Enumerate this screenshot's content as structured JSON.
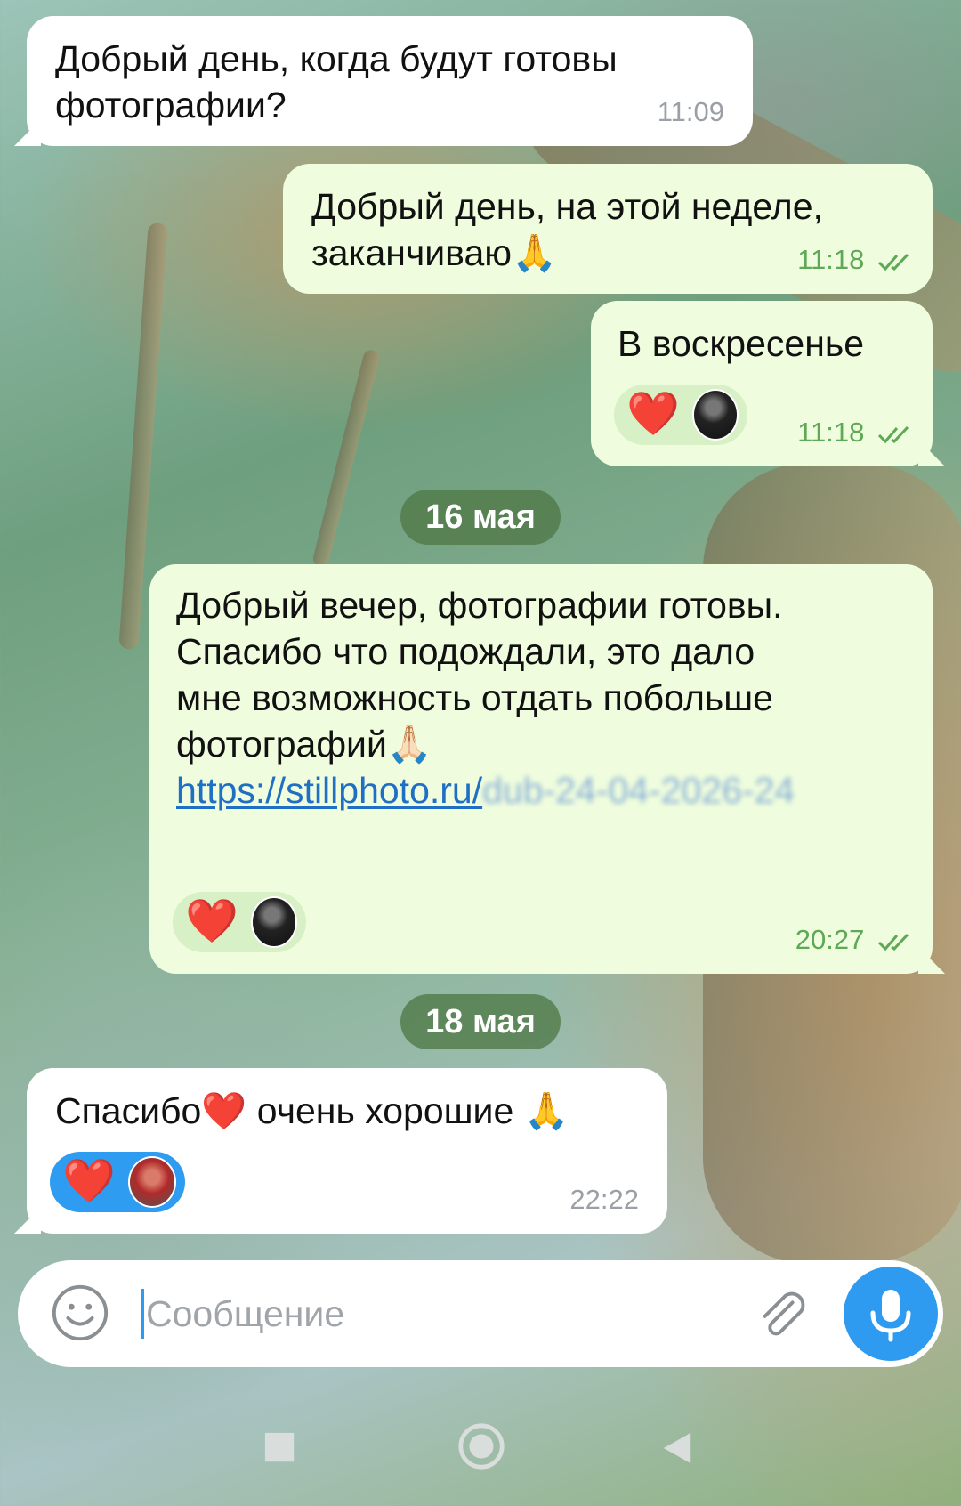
{
  "messages": [
    {
      "id": "m1",
      "direction": "in",
      "text": "Добрый день, когда будут готовы\nфотографии?",
      "time": "11:09"
    },
    {
      "id": "m2",
      "direction": "out",
      "text": "Добрый день, на этой неделе,\nзаканчиваю🙏",
      "time": "11:18"
    },
    {
      "id": "m3",
      "direction": "out",
      "text": "В воскресенье",
      "time": "11:18",
      "reaction": "❤️"
    },
    {
      "id": "m4",
      "direction": "out",
      "text": "Добрый вечер, фотографии готовы.\nСпасибо что подождали, это дало\nмне возможность отдать побольше\nфотографий🙏🏻",
      "link_visible": "https://stillphoto.ru/",
      "link_blurred": "dub-24-04-2026-24",
      "time": "20:27",
      "reaction": "❤️"
    },
    {
      "id": "m5",
      "direction": "in",
      "text": "Спасибо❤️ очень хорошие 🙏",
      "time": "22:22",
      "reaction": "❤️"
    }
  ],
  "dates": {
    "first": "16 мая",
    "second": "18 мая"
  },
  "composer": {
    "placeholder": "Сообщение",
    "emoji_icon": "smile-icon",
    "attach_icon": "paperclip-icon",
    "mic_icon": "microphone-icon"
  },
  "colors": {
    "incoming": "#ffffff",
    "outgoing": "#effdde",
    "accent": "#2f9bf0",
    "read_check": "#5fa855",
    "date_pill": "#50784a"
  },
  "navigation": {
    "icons": [
      "square-recents-icon",
      "circle-home-icon",
      "triangle-back-icon"
    ]
  }
}
